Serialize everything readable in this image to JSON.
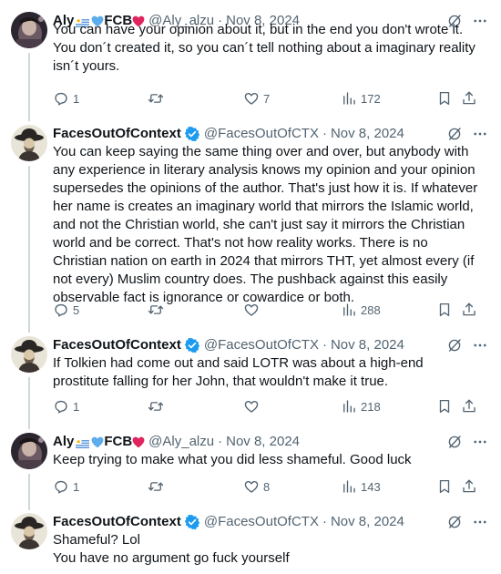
{
  "tweets": [
    {
      "author": "Aly",
      "author_suffix": "FCB",
      "handle": "@Aly_alzu",
      "separator": "·",
      "date": "Nov 8, 2024",
      "verified": false,
      "avatar": "aly",
      "text": "You can have your opinion about it, but in the end you don't wrote it. You don´t created it, so you can´t tell nothing about a imaginary reality isn´t yours.",
      "replies": "1",
      "retweets": "",
      "likes": "7",
      "views": "172"
    },
    {
      "author": "FacesOutOfContext",
      "author_suffix": "",
      "handle": "@FacesOutOfCTX",
      "separator": "·",
      "date": "Nov 8, 2024",
      "verified": true,
      "avatar": "faces",
      "text": "You can keep saying the same thing over and over, but anybody with any experience in literary analysis knows my opinion and your opinion supersedes the opinions of the author. That's just how it is. If whatever her name is creates an imaginary world that mirrors the Islamic world, and not the Christian world, she can't just say it mirrors the Christian world and be correct. That's not how reality works. There is no Christian nation on earth in 2024 that mirrors THT, yet almost every (if not every) Muslim country does. The pushback against this easily observable fact is ignorance or cowardice or both.",
      "replies": "5",
      "retweets": "",
      "likes": "",
      "views": "288"
    },
    {
      "author": "FacesOutOfContext",
      "author_suffix": "",
      "handle": "@FacesOutOfCTX",
      "separator": "·",
      "date": "Nov 8, 2024",
      "verified": true,
      "avatar": "faces",
      "text": "If Tolkien had come out and said LOTR was about a high-end prostitute falling for her John, that wouldn't make it true.",
      "replies": "1",
      "retweets": "",
      "likes": "",
      "views": "218"
    },
    {
      "author": "Aly",
      "author_suffix": "FCB",
      "handle": "@Aly_alzu",
      "separator": "·",
      "date": "Nov 8, 2024",
      "verified": false,
      "avatar": "aly",
      "text": "Keep trying to make what you did less shameful. Good luck",
      "replies": "1",
      "retweets": "",
      "likes": "8",
      "views": "143"
    },
    {
      "author": "FacesOutOfContext",
      "author_suffix": "",
      "handle": "@FacesOutOfCTX",
      "separator": "·",
      "date": "Nov 8, 2024",
      "verified": true,
      "avatar": "faces",
      "text": "Shameful? Lol\nYou have no argument go fuck yourself",
      "replies": "",
      "retweets": "",
      "likes": "",
      "views": ""
    }
  ],
  "colors": {
    "text": "#0f1419",
    "secondary": "#536471",
    "verified_blue": "#1d9bf0",
    "thread_line": "#cfd9de",
    "heart_red": "#e0245e",
    "heart_blue": "#5dadec"
  },
  "icons": [
    "reply-icon",
    "retweet-icon",
    "like-icon",
    "views-icon",
    "bookmark-icon",
    "share-icon",
    "grok-icon",
    "more-icon",
    "verified-badge-icon"
  ]
}
